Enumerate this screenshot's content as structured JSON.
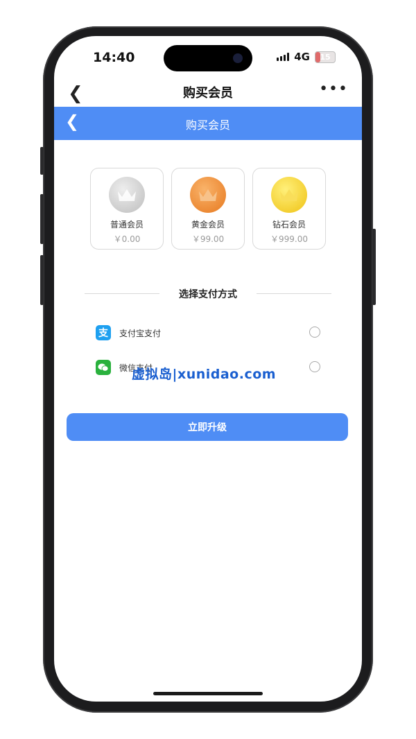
{
  "status_bar": {
    "time": "14:40",
    "network": "4G",
    "battery": "15",
    "battery_fraction": 0.15
  },
  "nav": {
    "title": "购买会员"
  },
  "header": {
    "title": "购买会员"
  },
  "memberships": [
    {
      "name": "普通会员",
      "price": "￥0.00",
      "color": "#c8c8c8"
    },
    {
      "name": "黄金会员",
      "price": "￥99.00",
      "color": "#ee8a2a"
    },
    {
      "name": "钻石会员",
      "price": "￥999.00",
      "color": "#f3cc1c"
    }
  ],
  "payment": {
    "section_title": "选择支付方式",
    "methods": [
      {
        "label": "支付宝支付",
        "icon": "alipay-icon",
        "color": "#1ea0f0"
      },
      {
        "label": "微信支付",
        "icon": "wechat-icon",
        "color": "#2ab13d"
      }
    ]
  },
  "watermark": "虚拟岛|xunidao.com",
  "upgrade_button": "立即升级"
}
